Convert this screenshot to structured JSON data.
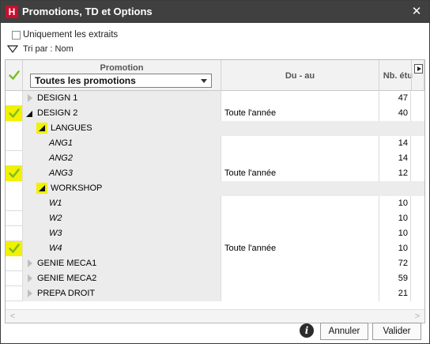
{
  "window": {
    "title": "Promotions, TD et Options",
    "logo_letter": "H",
    "close_glyph": "✕"
  },
  "filter": {
    "only_extracts_label": "Uniquement les extraits",
    "only_extracts_checked": false
  },
  "sort": {
    "label": "Tri par : Nom"
  },
  "table": {
    "columns": {
      "promotion": "Promotion",
      "dates": "Du - au",
      "count": "Nb. étu"
    },
    "promotion_filter": {
      "selected": "Toutes les promotions"
    },
    "rows": [
      {
        "level": 0,
        "name": "DESIGN 1",
        "dates": "",
        "count": "47",
        "checked": false,
        "expander": "collapsed"
      },
      {
        "level": 0,
        "name": "DESIGN 2",
        "dates": "Toute l'année",
        "count": "40",
        "checked": true,
        "expander": "expanded"
      },
      {
        "level": 1,
        "name": "LANGUES",
        "dates": "",
        "count": "",
        "checked": false,
        "expander": "expanded-box",
        "group": true
      },
      {
        "level": 2,
        "name": "ANG1",
        "dates": "",
        "count": "14",
        "checked": false,
        "expander": "none"
      },
      {
        "level": 2,
        "name": "ANG2",
        "dates": "",
        "count": "14",
        "checked": false,
        "expander": "none"
      },
      {
        "level": 2,
        "name": "ANG3",
        "dates": "Toute l'année",
        "count": "12",
        "checked": true,
        "expander": "none"
      },
      {
        "level": 1,
        "name": "WORKSHOP",
        "dates": "",
        "count": "",
        "checked": false,
        "expander": "expanded-box",
        "group": true
      },
      {
        "level": 2,
        "name": "W1",
        "dates": "",
        "count": "10",
        "checked": false,
        "expander": "none"
      },
      {
        "level": 2,
        "name": "W2",
        "dates": "",
        "count": "10",
        "checked": false,
        "expander": "none"
      },
      {
        "level": 2,
        "name": "W3",
        "dates": "",
        "count": "10",
        "checked": false,
        "expander": "none"
      },
      {
        "level": 2,
        "name": "W4",
        "dates": "Toute l'année",
        "count": "10",
        "checked": true,
        "expander": "none"
      },
      {
        "level": 0,
        "name": "GENIE MECA1",
        "dates": "",
        "count": "72",
        "checked": false,
        "expander": "collapsed"
      },
      {
        "level": 0,
        "name": "GENIE MECA2",
        "dates": "",
        "count": "59",
        "checked": false,
        "expander": "collapsed"
      },
      {
        "level": 0,
        "name": "PREPA DROIT",
        "dates": "",
        "count": "21",
        "checked": false,
        "expander": "collapsed"
      }
    ]
  },
  "footer": {
    "info_glyph": "i",
    "cancel_label": "Annuler",
    "ok_label": "Valider"
  },
  "colors": {
    "titlebar": "#404040",
    "logo": "#c8102e",
    "selection_highlight": "#f1f100",
    "checkmark": "#7cbd1e"
  }
}
